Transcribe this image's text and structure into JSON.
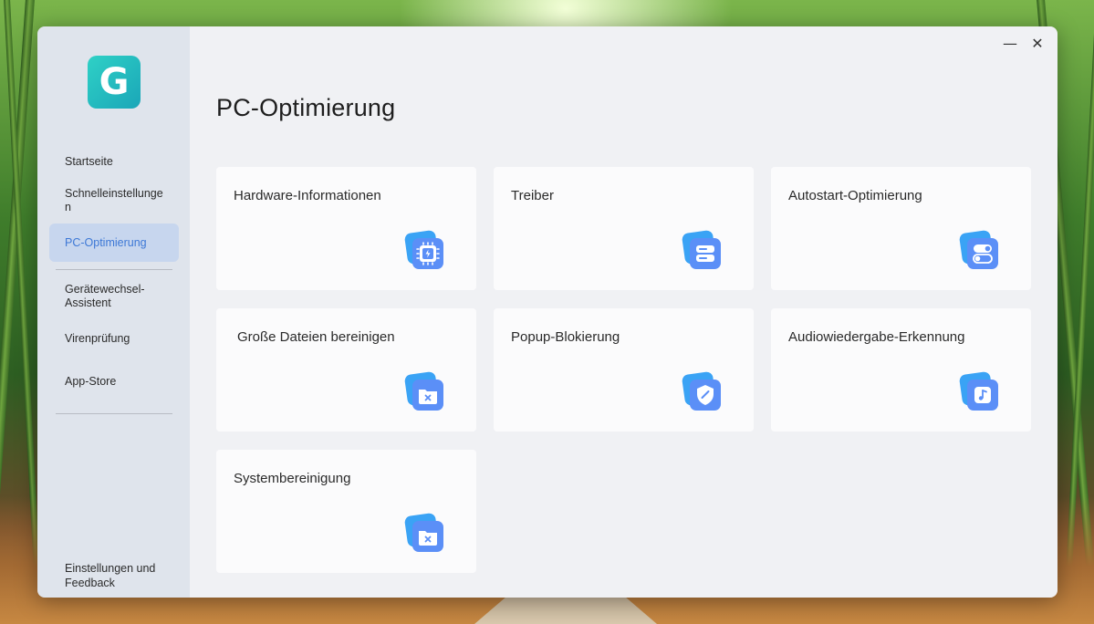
{
  "app": {
    "logo_letter": "G"
  },
  "sidebar": {
    "items": [
      {
        "label": "Startseite",
        "name": "sidebar-item-startseite",
        "active": false
      },
      {
        "label": "Schnelleinstellungen",
        "name": "sidebar-item-schnelleinstellungen",
        "active": false
      },
      {
        "label": "PC-Optimierung",
        "name": "sidebar-item-pc-optimierung",
        "active": true
      },
      {
        "label": "Gerätewechsel-Assistent",
        "name": "sidebar-item-geraetewechsel",
        "active": false
      },
      {
        "label": "Virenprüfung",
        "name": "sidebar-item-virenpruefung",
        "active": false
      },
      {
        "label": "App-Store",
        "name": "sidebar-item-app-store",
        "active": false
      }
    ],
    "footer": "Einstellungen und Feedback"
  },
  "window": {
    "minimize_glyph": "—",
    "close_glyph": "✕"
  },
  "main": {
    "title": "PC-Optimierung",
    "cards": [
      {
        "title": "Hardware-Informationen",
        "icon": "chip-icon"
      },
      {
        "title": "Treiber",
        "icon": "drive-icon"
      },
      {
        "title": "Autostart-Optimierung",
        "icon": "toggle-icon"
      },
      {
        "title": "Große Dateien bereinigen",
        "icon": "folder-clean-icon"
      },
      {
        "title": "Popup-Blokierung",
        "icon": "shield-icon"
      },
      {
        "title": "Audiowiedergabe-Erkennung",
        "icon": "music-icon"
      },
      {
        "title": "Systembereinigung",
        "icon": "folder-clean-icon"
      }
    ]
  },
  "colors": {
    "accent": "#3d78d6",
    "sidebar_bg": "#dfe4ec",
    "active_bg": "#c7d6ee",
    "main_bg": "#f0f1f4",
    "card_bg": "#fbfbfc",
    "icon_back": "#3aa3f5",
    "icon_front": "#5b8ff7",
    "logo": "#1fb6bf"
  }
}
